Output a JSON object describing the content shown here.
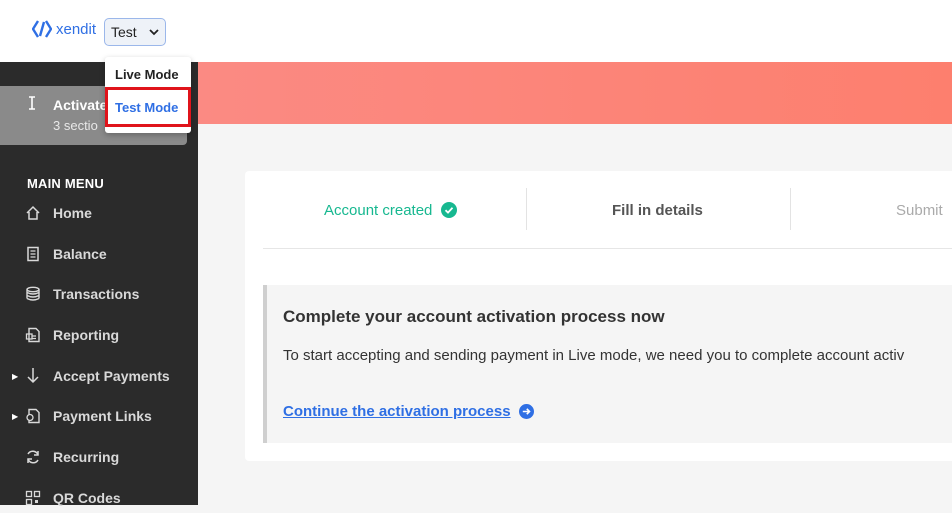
{
  "header": {
    "logo_text": "xendit",
    "mode_select": {
      "value": "Test"
    }
  },
  "mode_dropdown": {
    "options": [
      "Live Mode",
      "Test Mode"
    ],
    "highlighted": "Test Mode"
  },
  "sidebar": {
    "activate": {
      "title": "Activate",
      "subtitle": "3 sectio"
    },
    "menu_heading": "MAIN MENU",
    "items": [
      {
        "label": "Home",
        "icon": "home-icon"
      },
      {
        "label": "Balance",
        "icon": "balance-icon"
      },
      {
        "label": "Transactions",
        "icon": "coins-icon"
      },
      {
        "label": "Reporting",
        "icon": "report-icon"
      },
      {
        "label": "Accept Payments",
        "icon": "download-arrow-icon"
      },
      {
        "label": "Payment Links",
        "icon": "link-icon"
      },
      {
        "label": "Recurring",
        "icon": "recurring-icon"
      },
      {
        "label": "QR Codes",
        "icon": "qr-icon"
      }
    ]
  },
  "steps": [
    {
      "label": "Account created",
      "status": "done"
    },
    {
      "label": "Fill in details",
      "status": "current"
    },
    {
      "label": "Submit",
      "status": "upcoming"
    }
  ],
  "notice": {
    "title": "Complete your account activation process now",
    "text": "To start accepting and sending payment in Live mode, we need you to complete account activ",
    "link": "Continue the activation process"
  },
  "colors": {
    "brand": "#2f6fe4",
    "success": "#17b890",
    "sidebar_bg": "#2b2b2b",
    "highlight_border": "#e0141b",
    "banner": "#fd7f6e"
  }
}
